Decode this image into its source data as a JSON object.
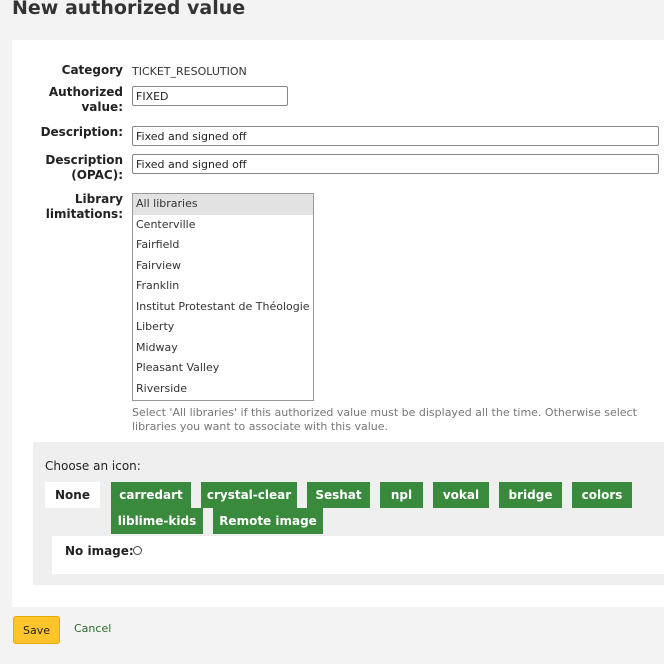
{
  "page": {
    "title": "New authorized value"
  },
  "form": {
    "category_label": "Category",
    "category_value": "TICKET_RESOLUTION",
    "authorized_value_label_line1": "Authorized",
    "authorized_value_label_line2": "value:",
    "authorized_value": "FIXED",
    "description_label": "Description:",
    "description_value": "Fixed and signed off",
    "description_opac_label_line1": "Description",
    "description_opac_label_line2": "(OPAC):",
    "description_opac_value": "Fixed and signed off",
    "library_label_line1": "Library",
    "library_label_line2": "limitations:",
    "libraries": [
      "All libraries",
      "Centerville",
      "Fairfield",
      "Fairview",
      "Franklin",
      "Institut Protestant de Théologie",
      "Liberty",
      "Midway",
      "Pleasant Valley",
      "Riverside"
    ],
    "selected_library": "All libraries",
    "library_hint": "Select 'All libraries' if this authorized value must be displayed all the time. Otherwise select libraries you want to associate with this value."
  },
  "icons": {
    "title": "Choose an icon:",
    "tabs": [
      "None",
      "carredart",
      "crystal-clear",
      "Seshat",
      "npl",
      "vokal",
      "bridge",
      "colors",
      "liblime-kids",
      "Remote image"
    ],
    "active_tab": "None",
    "no_image_label": "No image:"
  },
  "actions": {
    "save_label": "Save",
    "cancel_label": "Cancel"
  },
  "colors": {
    "accent_green": "#3a8a3d",
    "save_yellow": "#ffc32b",
    "link_green": "#2e6b2e"
  }
}
